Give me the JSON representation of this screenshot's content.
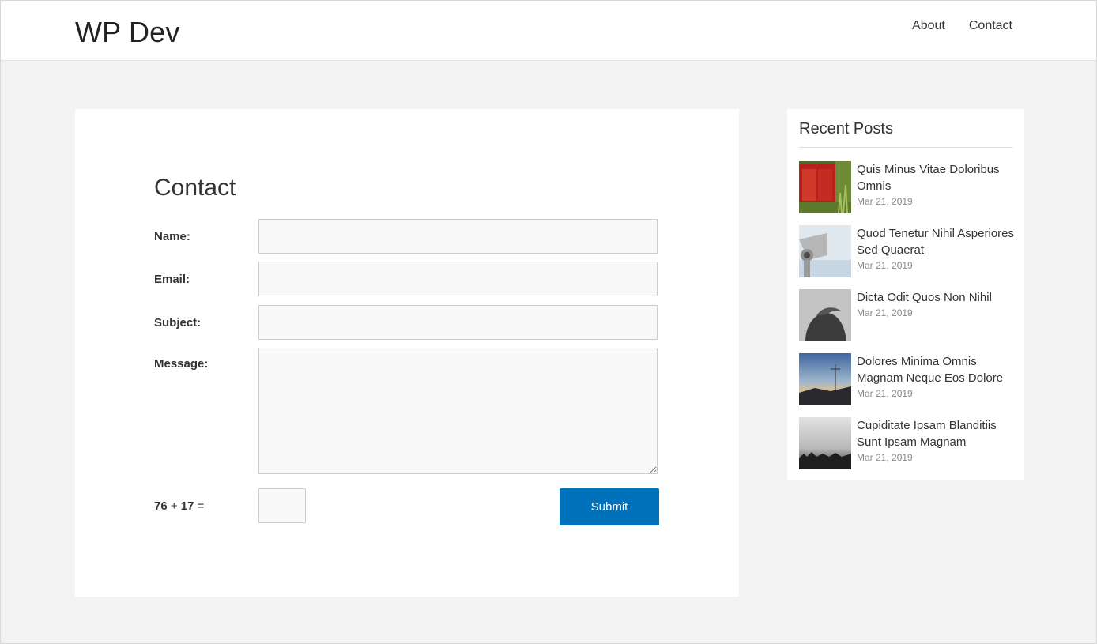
{
  "header": {
    "site_title": "WP Dev",
    "nav": [
      {
        "label": "About"
      },
      {
        "label": "Contact"
      }
    ]
  },
  "main": {
    "page_title": "Contact",
    "form": {
      "name_label": "Name:",
      "email_label": "Email:",
      "subject_label": "Subject:",
      "message_label": "Message:",
      "name_value": "",
      "email_value": "",
      "subject_value": "",
      "message_value": "",
      "captcha": {
        "a": "76",
        "op": "+",
        "b": "17",
        "eq": "=",
        "value": ""
      },
      "submit_label": "Submit"
    }
  },
  "sidebar": {
    "widget_title": "Recent Posts",
    "posts": [
      {
        "title": "Quis Minus Vitae Doloribus Omnis",
        "date": "Mar 21, 2019",
        "thumb": "red-door-photo"
      },
      {
        "title": "Quod Tenetur Nihil Asperiores Sed Quaerat",
        "date": "Mar 21, 2019",
        "thumb": "binocular-viewer-photo"
      },
      {
        "title": "Dicta Odit Quos Non Nihil",
        "date": "Mar 21, 2019",
        "thumb": "person-silhouette-photo"
      },
      {
        "title": "Dolores Minima Omnis Magnam Neque Eos Dolore",
        "date": "Mar 21, 2019",
        "thumb": "sunset-hills-photo"
      },
      {
        "title": "Cupiditate Ipsam Blanditiis Sunt Ipsam Magnam",
        "date": "Mar 21, 2019",
        "thumb": "foggy-field-photo"
      }
    ]
  },
  "colors": {
    "accent": "#0072bc",
    "background": "#f3f3f3",
    "card": "#ffffff"
  }
}
